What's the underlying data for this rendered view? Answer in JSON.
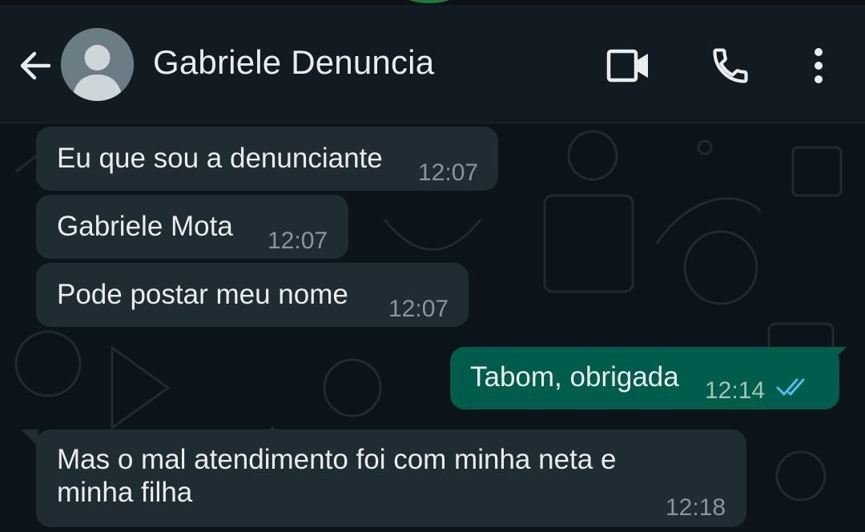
{
  "header": {
    "contact_name": "Gabriele Denuncia",
    "back_icon": "arrow-back-icon",
    "avatar_icon": "default-avatar-icon",
    "actions": [
      "video-call-icon",
      "phone-icon",
      "more-vert-icon"
    ]
  },
  "messages": [
    {
      "direction": "incoming",
      "text": "Eu que sou a denunciante",
      "time": "12:07"
    },
    {
      "direction": "incoming",
      "text": "Gabriele Mota",
      "time": "12:07"
    },
    {
      "direction": "incoming",
      "text": "Pode postar meu nome",
      "time": "12:07"
    },
    {
      "direction": "outgoing",
      "text": "Tabom, obrigada",
      "time": "12:14",
      "status": "read",
      "status_icon": "double-check-icon"
    },
    {
      "direction": "incoming",
      "text_lines": [
        "Mas o mal atendimento foi com minha neta e",
        "minha filha"
      ],
      "time": "12:18"
    }
  ],
  "colors": {
    "header_bg": "#111b21",
    "chat_bg": "#0b141a",
    "incoming_bubble": "#202c33",
    "outgoing_bubble": "#005c4b",
    "text": "#e9edef",
    "meta_text": "#8696a0",
    "read_ticks": "#53bdeb"
  }
}
